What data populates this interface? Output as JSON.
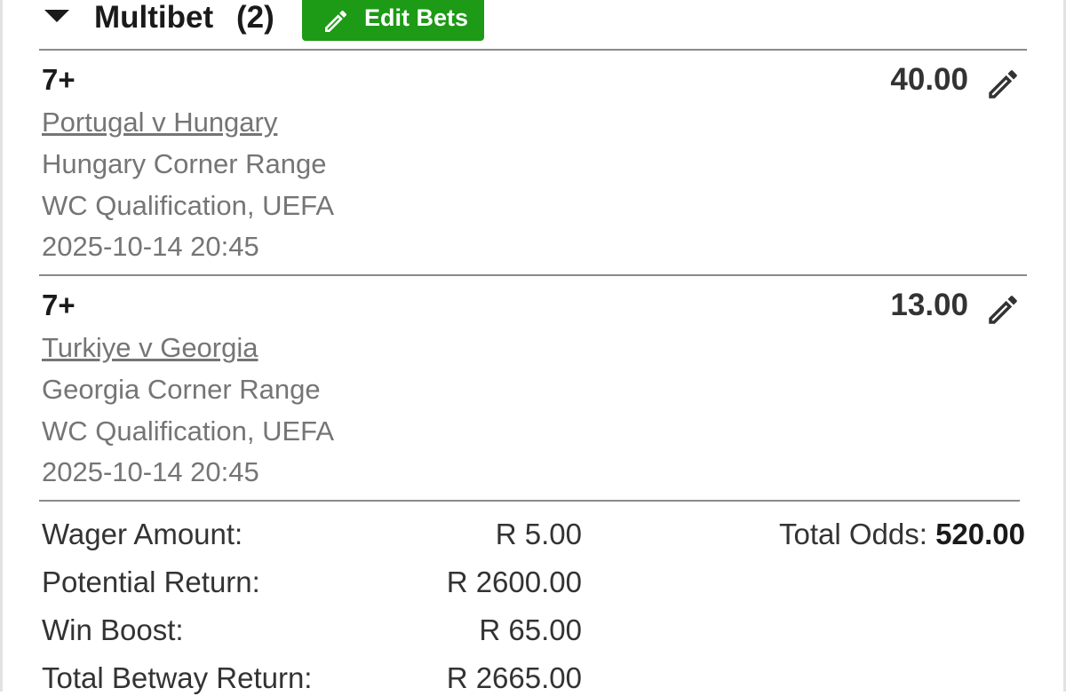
{
  "header": {
    "title": "Multibet",
    "count": "(2)",
    "edit_button_label": "Edit Bets"
  },
  "bets": [
    {
      "selection": "7+",
      "odds": "40.00",
      "match": "Portugal v Hungary",
      "market": "Hungary Corner Range",
      "competition": "WC Qualification, UEFA",
      "datetime": "2025-10-14 20:45"
    },
    {
      "selection": "7+",
      "odds": "13.00",
      "match": "Turkiye v Georgia",
      "market": "Georgia Corner Range",
      "competition": "WC Qualification, UEFA",
      "datetime": "2025-10-14 20:45"
    }
  ],
  "summary": {
    "wager_label": "Wager Amount:",
    "wager_value": "R 5.00",
    "potential_label": "Potential Return:",
    "potential_value": "R 2600.00",
    "boost_label": "Win Boost:",
    "boost_value": "R 65.00",
    "total_label": "Total Betway Return:",
    "total_value": "R 2665.00",
    "total_odds_label": "Total Odds:",
    "total_odds_value": "520.00"
  },
  "colors": {
    "accent_green": "#1d9a16",
    "muted_text": "#757575",
    "strong_text": "#1a1a1a"
  }
}
